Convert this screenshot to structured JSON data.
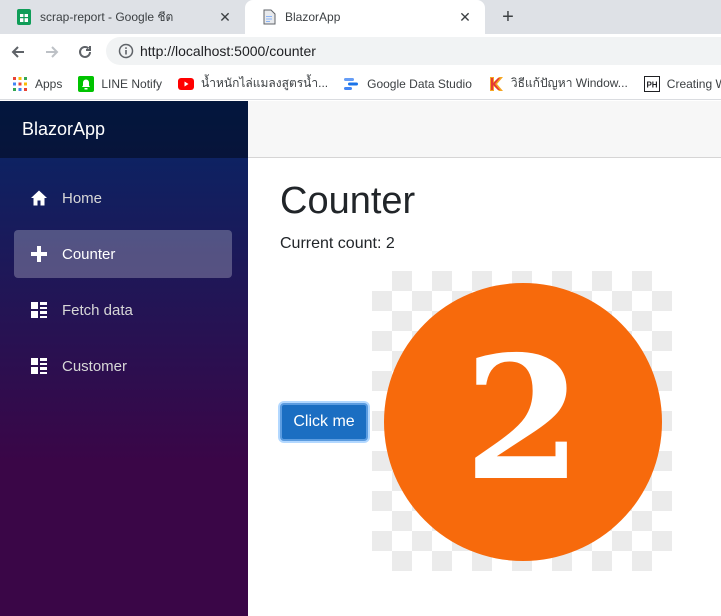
{
  "browser": {
    "tabs": [
      {
        "title": "scrap-report - Google ชีต",
        "favicon": "google-sheets-icon",
        "active": false
      },
      {
        "title": "BlazorApp",
        "favicon": "page-icon",
        "active": true
      }
    ],
    "close_glyph": "✕",
    "new_tab_glyph": "+",
    "url": "http://localhost:5000/counter",
    "bookmarks": [
      {
        "label": "Apps",
        "icon": "apps-grid-icon"
      },
      {
        "label": "LINE Notify",
        "icon": "line-bell-icon"
      },
      {
        "label": "น้ำหนักไล่แมลงสูตรน้ำ...",
        "icon": "youtube-icon"
      },
      {
        "label": "Google Data Studio",
        "icon": "data-studio-icon"
      },
      {
        "label": "วิธีแก้ปัญหา Window...",
        "icon": "k-icon"
      },
      {
        "label": "Creating We",
        "icon": "ph-icon"
      }
    ]
  },
  "app": {
    "brand": "BlazorApp",
    "nav": [
      {
        "label": "Home",
        "icon": "home-icon",
        "active": false
      },
      {
        "label": "Counter",
        "icon": "plus-icon",
        "active": true
      },
      {
        "label": "Fetch data",
        "icon": "list-icon",
        "active": false
      },
      {
        "label": "Customer",
        "icon": "list-icon",
        "active": false
      }
    ],
    "page_title": "Counter",
    "count_label": "Current count: 2",
    "button_label": "Click me",
    "badge_number": "2",
    "colors": {
      "button": "#1b6ec2",
      "badge": "#f76a0c",
      "sidebar_top": "#052767",
      "sidebar_bottom": "#3a0647"
    }
  }
}
